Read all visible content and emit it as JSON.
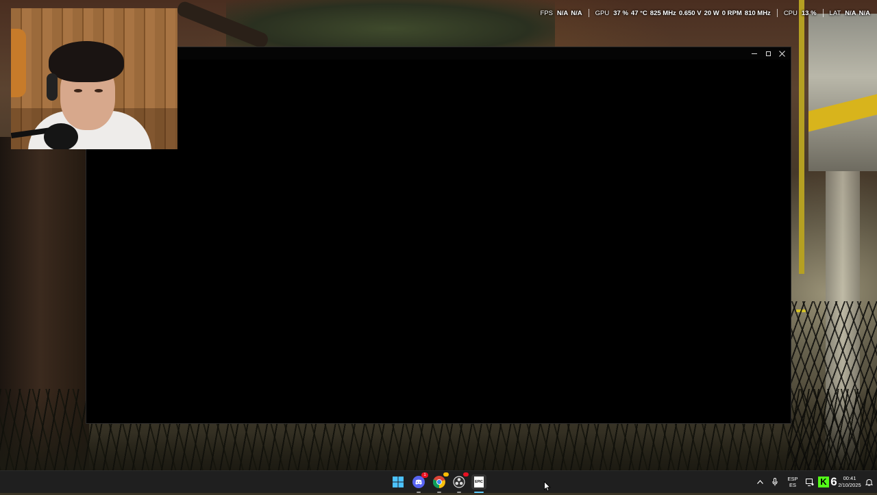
{
  "osd": {
    "fps_label": "FPS",
    "fps_value1": "N/A",
    "fps_value2": "N/A",
    "gpu_label": "GPU",
    "gpu_usage": "37 %",
    "gpu_temp": "47 °C",
    "gpu_clock": "825 MHz",
    "gpu_voltage": "0.650 V",
    "gpu_power": "20 W",
    "gpu_fan": "0 RPM",
    "gpu_mem_clock": "810 MHz",
    "cpu_label": "CPU",
    "cpu_usage": "13 %",
    "lat_label": "LAT",
    "lat_value1": "N/A",
    "lat_value2": "N/A"
  },
  "window": {
    "minimize_icon": "minimize-icon",
    "maximize_icon": "maximize-icon",
    "close_icon": "close-icon"
  },
  "taskbar": {
    "apps": [
      {
        "name": "start",
        "icon": "windows-logo-icon"
      },
      {
        "name": "discord",
        "icon": "discord-icon",
        "badge": "1"
      },
      {
        "name": "chrome",
        "icon": "chrome-icon"
      },
      {
        "name": "obs",
        "icon": "obs-icon"
      },
      {
        "name": "epic-games",
        "icon": "epic-games-icon",
        "label": "EPIC"
      }
    ],
    "tray": {
      "chevron_icon": "chevron-up-icon",
      "mic_icon": "microphone-icon",
      "lang_top": "ESP",
      "lang_bottom": "ES",
      "device_icon": "device-icon",
      "kick_icon": "kick-icon",
      "kick_letter": "K",
      "counter": "6",
      "time": "00:41",
      "date": "2/10/2025",
      "notification_icon": "notification-icon"
    }
  },
  "colors": {
    "taskbar_bg": "#1f1f1f",
    "accent": "#60cdff",
    "kick_green": "#53fc18",
    "discord": "#5865f2"
  }
}
